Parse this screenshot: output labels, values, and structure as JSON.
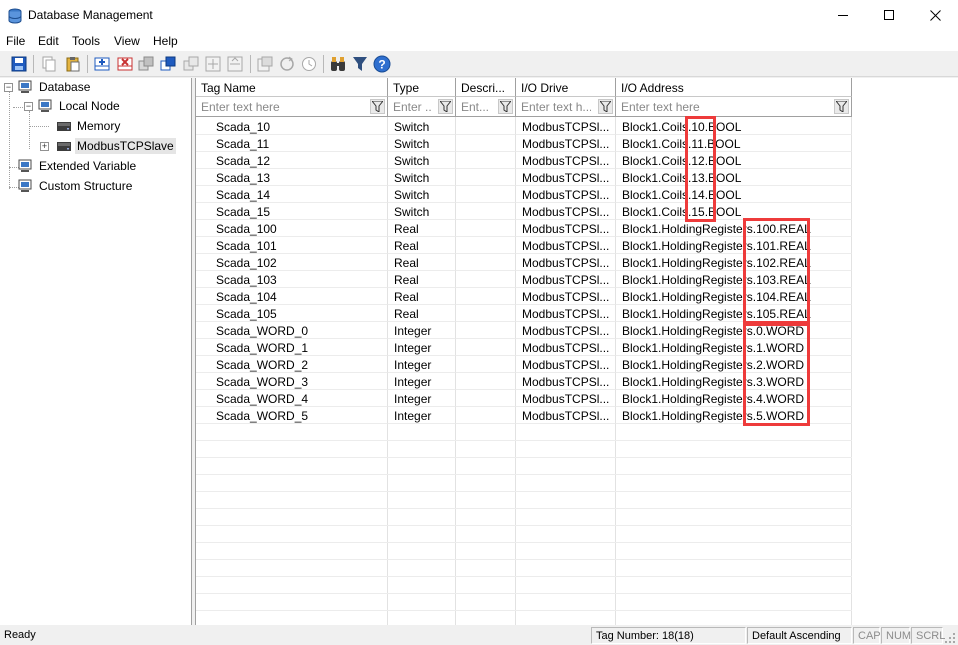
{
  "window": {
    "title": "Database Management"
  },
  "menu": [
    "File",
    "Edit",
    "Tools",
    "View",
    "Help"
  ],
  "toolbar": {
    "buttons": [
      "save-icon",
      "copy-icon",
      "paste-icon",
      "add-tag-icon",
      "delete-tag-icon",
      "duplicate-icon",
      "new-tag-icon",
      "move-up-icon",
      "move-down-icon",
      "export-icon",
      "refresh-icon",
      "history-icon",
      "find-icon",
      "filter-icon",
      "help-icon"
    ]
  },
  "tree": {
    "root": "Database",
    "local_node": "Local Node",
    "memory": "Memory",
    "modbus": "ModbusTCPSlave",
    "extended": "Extended Variable",
    "custom": "Custom Structure"
  },
  "grid": {
    "columns": [
      "Tag Name",
      "Type",
      "Descri...",
      "I/O Drive",
      "I/O Address"
    ],
    "filters": [
      "Enter text here",
      "Enter ...",
      "Ent...",
      "Enter text h...",
      "Enter text here"
    ],
    "rows": [
      [
        "Scada_10",
        "Switch",
        "",
        "ModbusTCPSl...",
        "Block1.Coils.10.BOOL"
      ],
      [
        "Scada_11",
        "Switch",
        "",
        "ModbusTCPSl...",
        "Block1.Coils.11.BOOL"
      ],
      [
        "Scada_12",
        "Switch",
        "",
        "ModbusTCPSl...",
        "Block1.Coils.12.BOOL"
      ],
      [
        "Scada_13",
        "Switch",
        "",
        "ModbusTCPSl...",
        "Block1.Coils.13.BOOL"
      ],
      [
        "Scada_14",
        "Switch",
        "",
        "ModbusTCPSl...",
        "Block1.Coils.14.BOOL"
      ],
      [
        "Scada_15",
        "Switch",
        "",
        "ModbusTCPSl...",
        "Block1.Coils.15.BOOL"
      ],
      [
        "Scada_100",
        "Real",
        "",
        "ModbusTCPSl...",
        "Block1.HoldingRegisters.100.REAL"
      ],
      [
        "Scada_101",
        "Real",
        "",
        "ModbusTCPSl...",
        "Block1.HoldingRegisters.101.REAL"
      ],
      [
        "Scada_102",
        "Real",
        "",
        "ModbusTCPSl...",
        "Block1.HoldingRegisters.102.REAL"
      ],
      [
        "Scada_103",
        "Real",
        "",
        "ModbusTCPSl...",
        "Block1.HoldingRegisters.103.REAL"
      ],
      [
        "Scada_104",
        "Real",
        "",
        "ModbusTCPSl...",
        "Block1.HoldingRegisters.104.REAL"
      ],
      [
        "Scada_105",
        "Real",
        "",
        "ModbusTCPSl...",
        "Block1.HoldingRegisters.105.REAL"
      ],
      [
        "Scada_WORD_0",
        "Integer",
        "",
        "ModbusTCPSl...",
        "Block1.HoldingRegisters.0.WORD"
      ],
      [
        "Scada_WORD_1",
        "Integer",
        "",
        "ModbusTCPSl...",
        "Block1.HoldingRegisters.1.WORD"
      ],
      [
        "Scada_WORD_2",
        "Integer",
        "",
        "ModbusTCPSl...",
        "Block1.HoldingRegisters.2.WORD"
      ],
      [
        "Scada_WORD_3",
        "Integer",
        "",
        "ModbusTCPSl...",
        "Block1.HoldingRegisters.3.WORD"
      ],
      [
        "Scada_WORD_4",
        "Integer",
        "",
        "ModbusTCPSl...",
        "Block1.HoldingRegisters.4.WORD"
      ],
      [
        "Scada_WORD_5",
        "Integer",
        "",
        "ModbusTCPSl...",
        "Block1.HoldingRegisters.5.WORD"
      ]
    ]
  },
  "highlight_color": "#ee3b3b",
  "status": {
    "ready": "Ready",
    "tag_number": "Tag Number: 18(18)",
    "sort": "Default Ascending",
    "cap": "CAP",
    "num": "NUM",
    "scrl": "SCRL"
  }
}
